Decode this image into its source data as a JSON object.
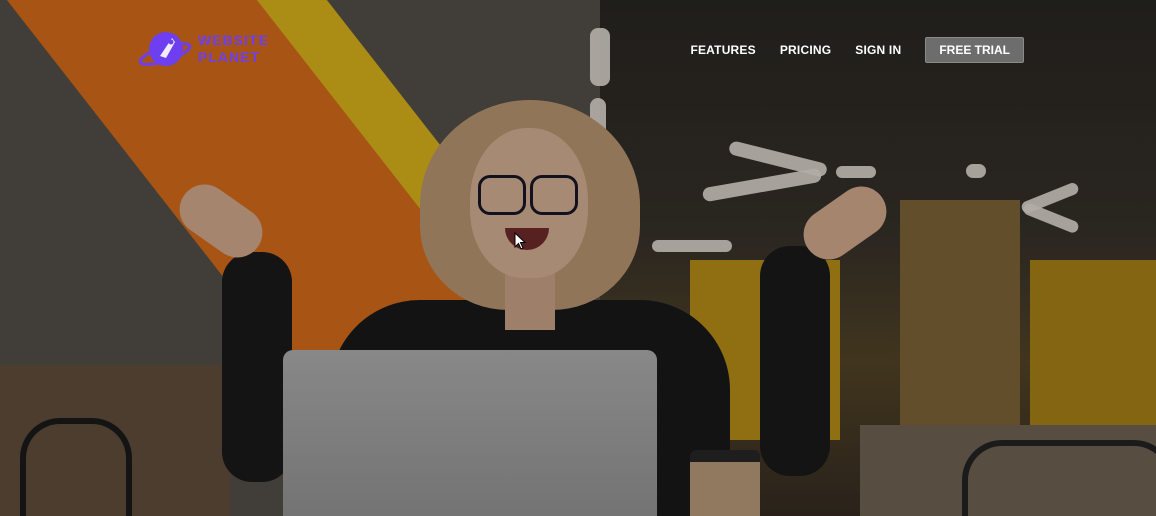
{
  "brand": {
    "line1": "WEBSITE",
    "line2": "PLANET",
    "logo_icon": "planet-rocket-icon",
    "color": "#6d3ff0"
  },
  "nav": {
    "features": "FEATURES",
    "pricing": "PRICING",
    "sign_in": "SIGN IN",
    "free_trial": "FREE TRIAL"
  },
  "hero": {
    "image": "woman-with-laptop-in-office-photo"
  }
}
